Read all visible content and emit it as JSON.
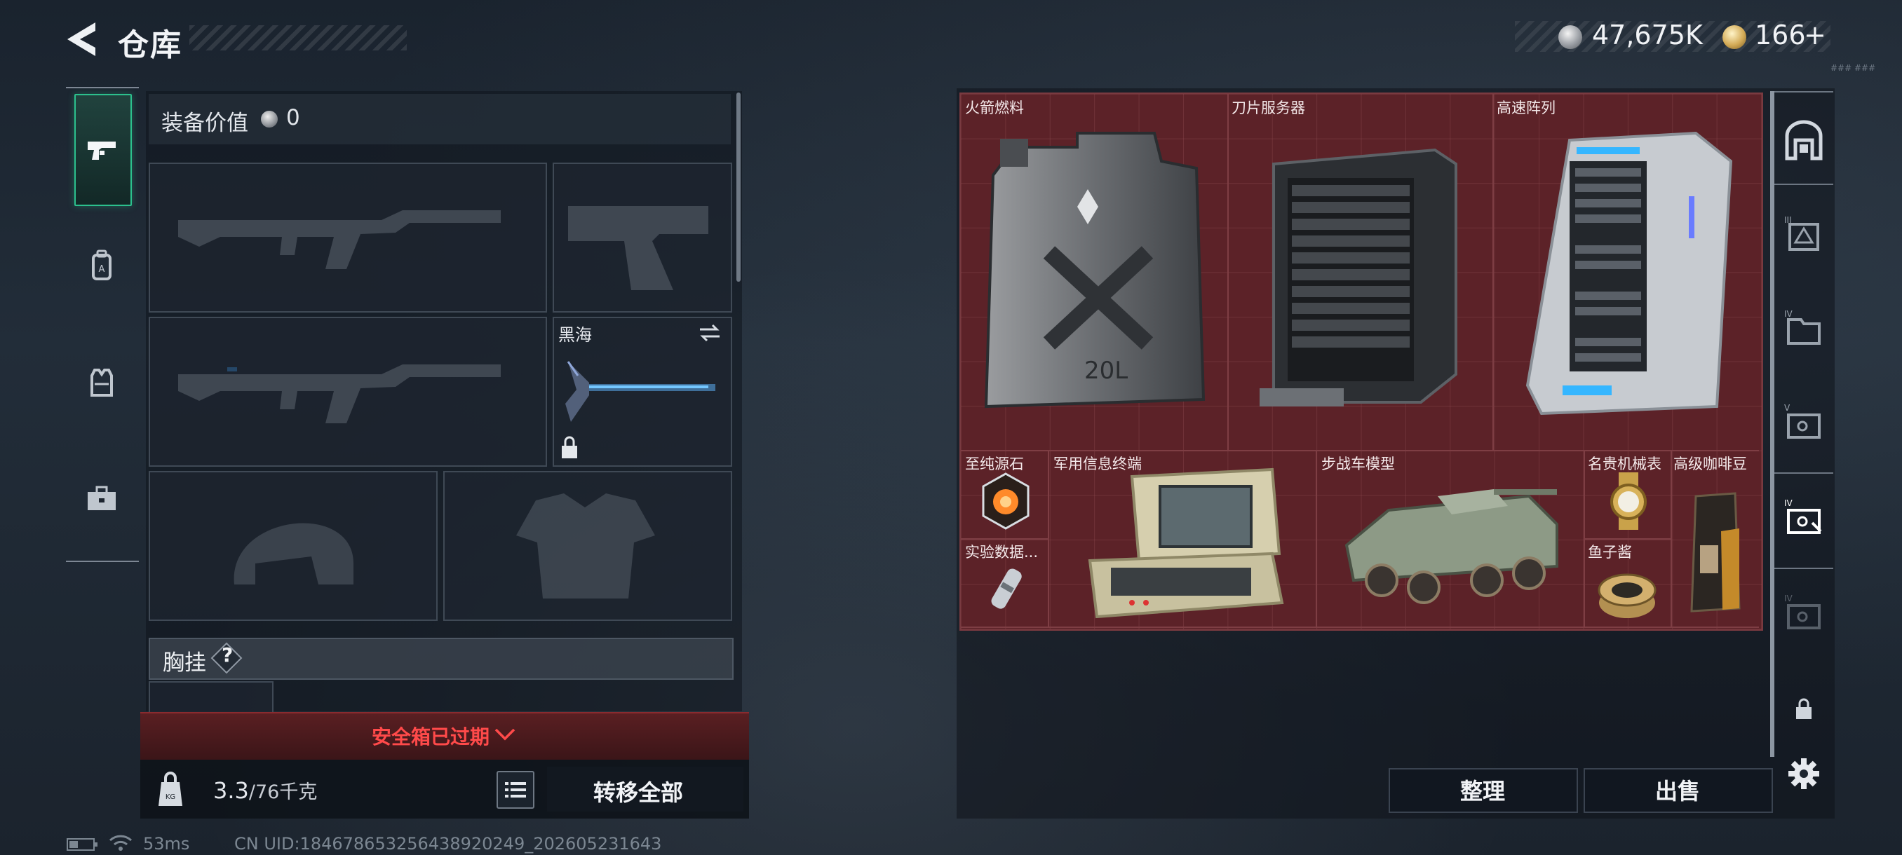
{
  "header": {
    "title": "仓库",
    "currency_primary": "47,675K",
    "currency_secondary": "166",
    "currency_secondary_suffix": "+",
    "version_text": "### ###"
  },
  "left_nav": {
    "items": [
      {
        "name": "weapon-tab",
        "icon": "pistol-icon",
        "active": true
      },
      {
        "name": "backpack-tab",
        "icon": "backpack-icon",
        "active": false
      },
      {
        "name": "vest-tab",
        "icon": "vest-icon",
        "active": false
      },
      {
        "name": "toolbox-tab",
        "icon": "toolbox-icon",
        "active": false
      }
    ]
  },
  "loadout": {
    "equipment_value_label": "装备价值",
    "equipment_value": "0",
    "melee_label": "黑海",
    "chest_rig_label": "胸挂",
    "chest_rig_help": "?",
    "safe_box_status": "安全箱已过期",
    "weight_current": "3.3",
    "weight_max": "/76千克",
    "transfer_all_label": "转移全部"
  },
  "status_bar": {
    "ping": "53ms",
    "uid": "CN UID:1846786532564389202​49_202605231643"
  },
  "stash": {
    "items": [
      {
        "name": "火箭燃料",
        "icon": "jerrycan-icon"
      },
      {
        "name": "刀片服务器",
        "icon": "server-rack-icon"
      },
      {
        "name": "高速阵列",
        "icon": "storage-array-icon"
      },
      {
        "name": "至纯源石",
        "icon": "gem-icon"
      },
      {
        "name": "军用信息终端",
        "icon": "terminal-case-icon"
      },
      {
        "name": "步战车模型",
        "icon": "armored-vehicle-icon"
      },
      {
        "name": "名贵机械表",
        "icon": "watch-icon"
      },
      {
        "name": "高级咖啡豆",
        "icon": "coffee-bag-icon"
      },
      {
        "name": "实验数据...",
        "icon": "data-capsule-icon"
      },
      {
        "name": "鱼子酱",
        "icon": "caviar-tin-icon"
      }
    ],
    "sort_label": "整理",
    "sell_label": "出售"
  },
  "right_nav": {
    "items": [
      "safe-icon",
      "tier-3-crate-icon",
      "tier-4-folder-icon",
      "tier-5-case-icon",
      "tier-4-case-active-icon",
      "tier-4-case-icon",
      "lock-icon"
    ],
    "settings_icon": "gear-icon"
  },
  "colors": {
    "accent_green": "#2cc08d",
    "stash_red": "#5c2228",
    "warning_red": "#ff4a4a"
  }
}
